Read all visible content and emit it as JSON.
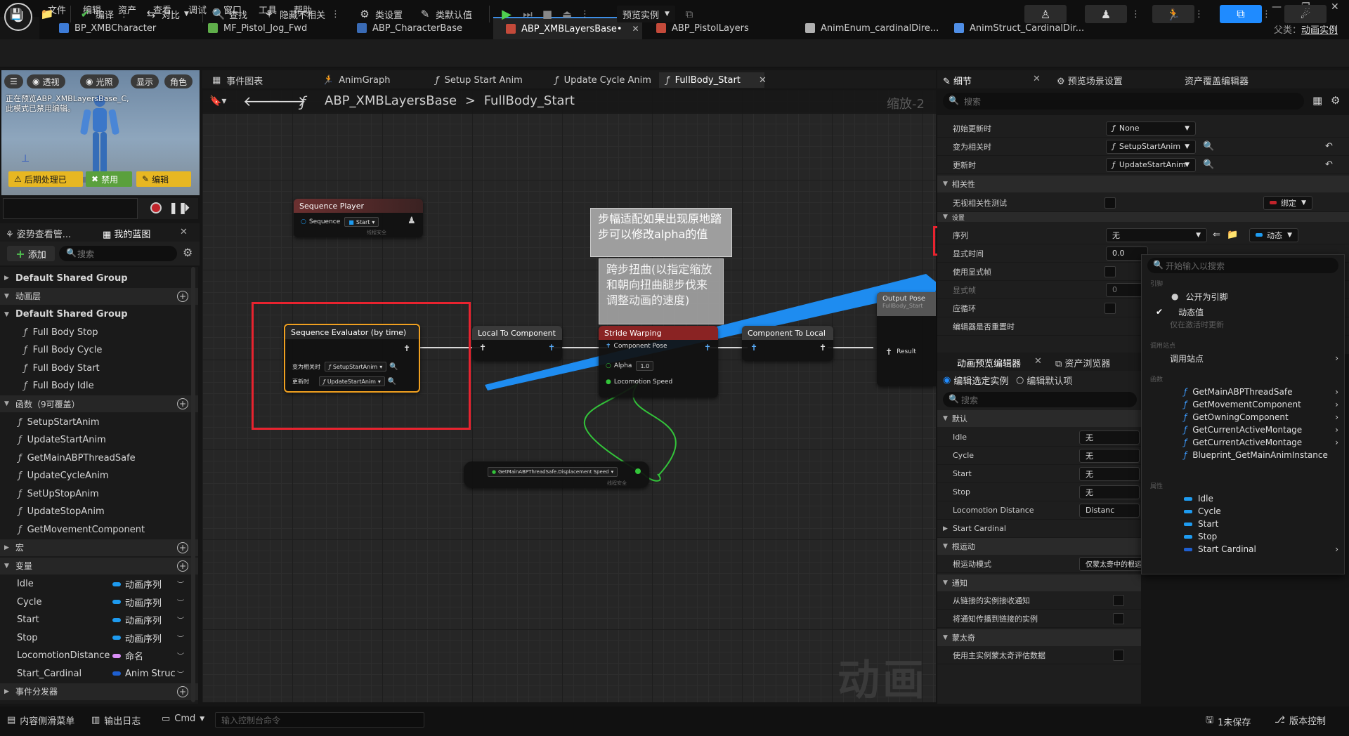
{
  "menu": [
    "文件",
    "编辑",
    "资产",
    "查看",
    "调试",
    "窗口",
    "工具",
    "帮助"
  ],
  "logo": "U",
  "asset_tabs": [
    {
      "label": "BP_XMBCharacter",
      "color": "#3d7bd6"
    },
    {
      "label": "MF_Pistol_Jog_Fwd",
      "color": "#5fae4a"
    },
    {
      "label": "ABP_CharacterBase",
      "color": "#3a6bb5"
    },
    {
      "label": "ABP_XMBLayersBase•",
      "color": "#c44a3a",
      "active": true
    },
    {
      "label": "ABP_PistolLayers",
      "color": "#c44a3a"
    },
    {
      "label": "AnimEnum_cardinalDire...",
      "color": "#b0b0b0"
    },
    {
      "label": "AnimStruct_CardinalDir...",
      "color": "#4f8ee6"
    }
  ],
  "parent": {
    "label": "父类：",
    "value": "动画实例"
  },
  "toolbar": {
    "compile": "编译",
    "diff": "对比",
    "find": "查找",
    "hide_unrelated": "隐藏不相关",
    "class_settings": "类设置",
    "class_defaults": "类默认值",
    "preview_instance": "预览实例"
  },
  "viewport": {
    "pills": [
      "透视",
      "光照",
      "显示",
      "角色"
    ],
    "notice_line1": "正在预览ABP_XMBLayersBase_C,",
    "notice_line2": "此模式已禁用编辑。",
    "postprocess": "后期处理已",
    "disabled": "禁用",
    "edit": "编辑"
  },
  "left_tabs": {
    "pose_watch": "姿势查看管...",
    "my_blueprint": "我的蓝图"
  },
  "left_panel": {
    "add": "添加",
    "search_placeholder": "搜索",
    "rows": [
      {
        "type": "grp",
        "label": "Default Shared Group",
        "collapsed": true
      },
      {
        "type": "cat",
        "label": "动画层"
      },
      {
        "type": "grp",
        "label": "Default Shared Group"
      },
      {
        "type": "fn2",
        "label": "Full Body Stop"
      },
      {
        "type": "fn2",
        "label": "Full Body Cycle"
      },
      {
        "type": "fn2",
        "label": "Full Body Start"
      },
      {
        "type": "fn2",
        "label": "Full Body Idle"
      },
      {
        "type": "cat",
        "label": "函数（9可覆盖）"
      },
      {
        "type": "fn",
        "label": "SetupStartAnim"
      },
      {
        "type": "fn",
        "label": "UpdateStartAnim"
      },
      {
        "type": "fn",
        "label": "GetMainABPThreadSafe"
      },
      {
        "type": "fn",
        "label": "UpdateCycleAnim"
      },
      {
        "type": "fn",
        "label": "SetUpStopAnim"
      },
      {
        "type": "fn",
        "label": "UpdateStopAnim"
      },
      {
        "type": "fn",
        "label": "GetMovementComponent"
      },
      {
        "type": "cat",
        "label": "宏",
        "collapsed": true
      },
      {
        "type": "cat",
        "label": "变量"
      },
      {
        "type": "var",
        "label": "Idle",
        "vtype": "动画序列",
        "color": "#1e9bf0"
      },
      {
        "type": "var",
        "label": "Cycle",
        "vtype": "动画序列",
        "color": "#1e9bf0"
      },
      {
        "type": "var",
        "label": "Start",
        "vtype": "动画序列",
        "color": "#1e9bf0"
      },
      {
        "type": "var",
        "label": "Stop",
        "vtype": "动画序列",
        "color": "#1e9bf0"
      },
      {
        "type": "var",
        "label": "LocomotionDistance",
        "vtype": "命名",
        "color": "#d98ef5"
      },
      {
        "type": "var",
        "label": "Start_Cardinal",
        "vtype": "Anim Struc",
        "color": "#1e5fd0"
      },
      {
        "type": "cat",
        "label": "事件分发器",
        "collapsed": true
      }
    ]
  },
  "graph_tabs": [
    "事件图表",
    "AnimGraph",
    "Setup Start Anim",
    "Update Cycle Anim",
    "FullBody_Start"
  ],
  "breadcrumb": {
    "root": "ABP_XMBLayersBase",
    "sep": ">",
    "leaf": "FullBody_Start"
  },
  "zoom": "缩放-2",
  "watermark": "动画",
  "nodes": {
    "seq_player": {
      "title": "Sequence Player",
      "pin": "Sequence",
      "value": "Start",
      "note": "线程安全"
    },
    "seq_eval": {
      "title": "Sequence Evaluator (by time)",
      "pin1": "变为相关时",
      "val1": "SetupStartAnim",
      "pin2": "更新时",
      "val2": "UpdateStartAnim"
    },
    "local_to_comp": {
      "title": "Local To Component"
    },
    "stride": {
      "title": "Stride Warping",
      "pin1": "Component Pose",
      "pin2": "Alpha",
      "alpha": "1.0",
      "pin3": "Locomotion Speed"
    },
    "comp_to_local": {
      "title": "Component To Local"
    },
    "output_pose": {
      "title": "Output Pose",
      "sub": "FullBody_Start",
      "pin": "Result"
    },
    "getter": {
      "label": "GetMainABPThreadSafe.Displacement Speed",
      "note": "线程安全"
    }
  },
  "comments": {
    "c1": "步幅适配如果出现原地踏步可以修改alpha的值",
    "c2": "跨步扭曲(以指定缩放和朝向扭曲腿步伐来调整动画的速度)"
  },
  "details_tabs": {
    "details": "细节",
    "preview_settings": "预览场景设置",
    "asset_override": "资产覆盖编辑器"
  },
  "details": {
    "search_placeholder": "搜索",
    "initial_update": {
      "label": "初始更新时",
      "value": "None"
    },
    "become_relevant": {
      "label": "变为相关时",
      "value": "SetupStartAnim"
    },
    "on_update": {
      "label": "更新时",
      "value": "UpdateStartAnim"
    },
    "relevancy": "相关性",
    "ignore_relevancy": "无视相关性测试",
    "bind": "绑定",
    "settings": "设置",
    "sequence": {
      "label": "序列",
      "value": "无",
      "mode": "动态"
    },
    "explicit_time": {
      "label": "显式时间",
      "value": "0.0"
    },
    "use_explicit_frame": "使用显式帧",
    "explicit_frame": {
      "label": "显式帧",
      "value": "0"
    },
    "should_loop": "应循环",
    "reinit": "编辑器是否重置时"
  },
  "bottom_tabs": {
    "anim_preview": "动画预览编辑器",
    "asset_browser": "资产浏览器"
  },
  "preview": {
    "edit_instance": "编辑选定实例",
    "edit_defaults": "编辑默认项",
    "search_placeholder": "搜索",
    "default": "默认",
    "rows": [
      {
        "label": "Idle",
        "value": "无"
      },
      {
        "label": "Cycle",
        "value": "无"
      },
      {
        "label": "Start",
        "value": "无"
      },
      {
        "label": "Stop",
        "value": "无"
      },
      {
        "label": "Locomotion Distance",
        "value": "Distanc"
      }
    ],
    "start_cardinal": "Start Cardinal",
    "root_motion": "根运动",
    "root_motion_mode": {
      "label": "根运动模式",
      "value": "仅蒙太奇中的根运动"
    },
    "notify": "通知",
    "recv_notify": "从链接的实例接收通知",
    "propagate_notify": "将通知传播到链接的实例",
    "montage": "蒙太奇",
    "use_main_montage": "使用主实例蒙太奇评估数据"
  },
  "dropdown": {
    "search_placeholder": "开始输入以搜索",
    "hdr_ref": "引脚",
    "expose_pin": "公开为引脚",
    "dynamic_value": "动态值",
    "only_on_activate": "仅在激活时更新",
    "hdr_call": "调用站点",
    "call_site": "调用站点",
    "hdr_fn": "函数",
    "functions": [
      "GetMainABPThreadSafe",
      "GetMovementComponent",
      "GetOwningComponent",
      "GetCurrentActiveMontage",
      "GetCurrentActiveMontage",
      "Blueprint_GetMainAnimInstance"
    ],
    "hdr_prop": "属性",
    "properties": [
      "Idle",
      "Cycle",
      "Start",
      "Stop",
      "Start Cardinal"
    ]
  },
  "statusbar": {
    "content_drawer": "内容侧滑菜单",
    "output_log": "输出日志",
    "cmd": "Cmd",
    "cmd_placeholder": "输入控制台命令",
    "unsaved": "1未保存",
    "source_control": "版本控制"
  },
  "colors": {
    "accent_blue": "#1f8bff",
    "highlight_red": "#e8232f",
    "seq_eval_border": "#f0a020",
    "stride_head": "#8a2323"
  }
}
